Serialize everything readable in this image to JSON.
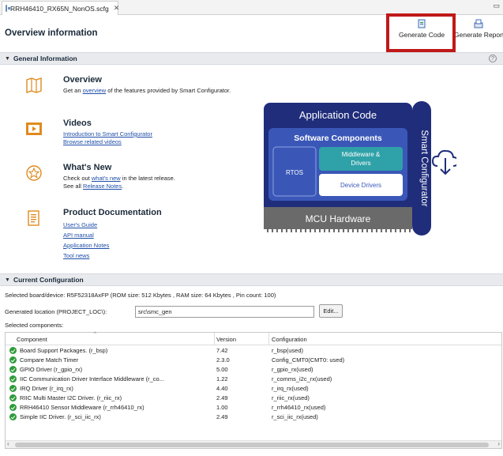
{
  "tab": {
    "title": "RRH46410_RX65N_NonOS.scfg"
  },
  "header": {
    "title": "Overview information",
    "generate_code": "Generate Code",
    "generate_report": "Generate Report"
  },
  "general": {
    "title": "General Information",
    "items": [
      {
        "heading": "Overview",
        "text_before": "Get an ",
        "link": "overview",
        "text_after": " of the features provided by Smart Configurator."
      },
      {
        "heading": "Videos",
        "links": [
          "Introduction to Smart Configurator",
          "Browse related videos"
        ]
      },
      {
        "heading": "What's New",
        "line1_before": "Check out ",
        "line1_link": "what's new",
        "line1_after": " in the latest release.",
        "line2_before": "See all ",
        "line2_link": "Release Notes",
        "line2_after": "."
      },
      {
        "heading": "Product Documentation",
        "links": [
          "User's Guide",
          "API manual",
          "Application Notes",
          "Tool news"
        ]
      }
    ]
  },
  "diagram": {
    "application_code": "Application Code",
    "software_components": "Software Components",
    "rtos": "RTOS",
    "middleware_1": "Middleware &",
    "middleware_2": "Drivers",
    "device_drivers": "Device Drivers",
    "mcu_hardware": "MCU Hardware",
    "smart_configurator": "Smart Configurator"
  },
  "config": {
    "title": "Current Configuration",
    "device_line": "Selected board/device: R5F52318AxFP (ROM size: 512 Kbytes , RAM size: 64 Kbytes , Pin count: 100)",
    "location_label": "Generated location (PROJECT_LOC\\):",
    "location_value": "src\\smc_gen",
    "edit_button": "Edit...",
    "selected_label": "Selected components:",
    "columns": [
      "Component",
      "Version",
      "Configuration"
    ],
    "rows": [
      {
        "component": "Board Support Packages. (r_bsp)",
        "version": "7.42",
        "configuration": "r_bsp(used)"
      },
      {
        "component": "Compare Match Timer",
        "version": "2.3.0",
        "configuration": "Config_CMT0(CMT0: used)"
      },
      {
        "component": "GPIO Driver (r_gpio_rx)",
        "version": "5.00",
        "configuration": "r_gpio_rx(used)"
      },
      {
        "component": "IIC Communication Driver Interface Middleware (r_co...",
        "version": "1.22",
        "configuration": "r_comms_i2c_rx(used)"
      },
      {
        "component": "IRQ Driver (r_irq_rx)",
        "version": "4.40",
        "configuration": "r_irq_rx(used)"
      },
      {
        "component": "RIIC Multi Master I2C Driver. (r_riic_rx)",
        "version": "2.49",
        "configuration": "r_riic_rx(used)"
      },
      {
        "component": "RRH46410 Sensor Middleware (r_rrh46410_rx)",
        "version": "1.00",
        "configuration": "r_rrh46410_rx(used)"
      },
      {
        "component": "Simple IIC Driver. (r_sci_iic_rx)",
        "version": "2.49",
        "configuration": "r_sci_iic_rx(used)"
      }
    ]
  },
  "colors": {
    "navy": "#1f2d7a",
    "accent": "#3a57b8",
    "highlight": "#c01818",
    "status_ok": "#2e9b3a"
  }
}
